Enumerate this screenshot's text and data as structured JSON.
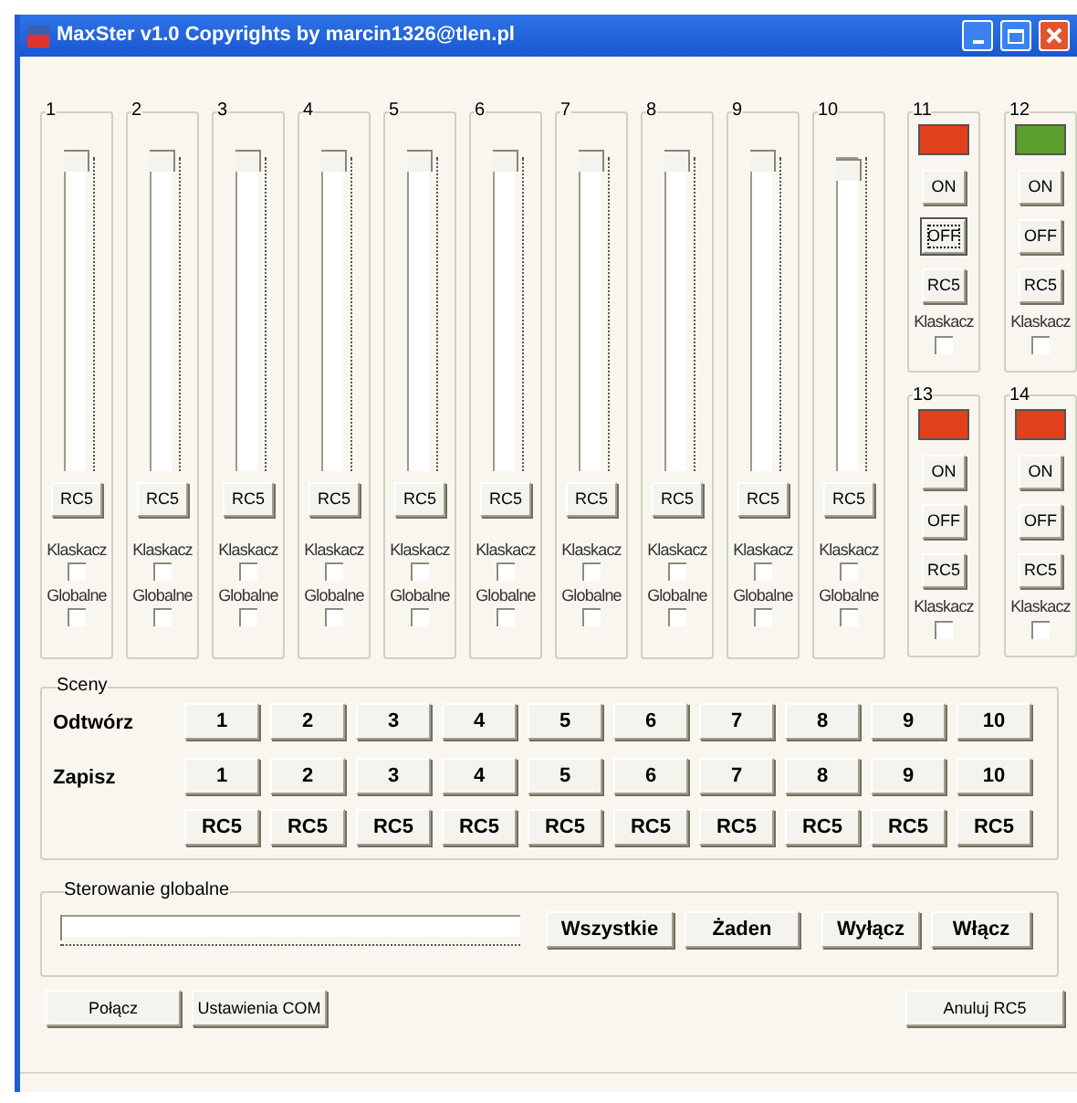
{
  "window": {
    "title": "MaxSter v1.0 Copyrights by marcin1326@tlen.pl"
  },
  "channels": [
    {
      "label": "1",
      "level": 1,
      "rc5": "RC5",
      "clap_label": "Klaskacz",
      "clap_checked": false,
      "global_label": "Globalne",
      "global_checked": false
    },
    {
      "label": "2",
      "level": 1,
      "rc5": "RC5",
      "clap_label": "Klaskacz",
      "clap_checked": false,
      "global_label": "Globalne",
      "global_checked": false
    },
    {
      "label": "3",
      "level": 1,
      "rc5": "RC5",
      "clap_label": "Klaskacz",
      "clap_checked": false,
      "global_label": "Globalne",
      "global_checked": false
    },
    {
      "label": "4",
      "level": 1,
      "rc5": "RC5",
      "clap_label": "Klaskacz",
      "clap_checked": false,
      "global_label": "Globalne",
      "global_checked": false
    },
    {
      "label": "5",
      "level": 1,
      "rc5": "RC5",
      "clap_label": "Klaskacz",
      "clap_checked": false,
      "global_label": "Globalne",
      "global_checked": false
    },
    {
      "label": "6",
      "level": 1,
      "rc5": "RC5",
      "clap_label": "Klaskacz",
      "clap_checked": false,
      "global_label": "Globalne",
      "global_checked": false
    },
    {
      "label": "7",
      "level": 1,
      "rc5": "RC5",
      "clap_label": "Klaskacz",
      "clap_checked": false,
      "global_label": "Globalne",
      "global_checked": false
    },
    {
      "label": "8",
      "level": 1,
      "rc5": "RC5",
      "clap_label": "Klaskacz",
      "clap_checked": false,
      "global_label": "Globalne",
      "global_checked": false
    },
    {
      "label": "9",
      "level": 1,
      "rc5": "RC5",
      "clap_label": "Klaskacz",
      "clap_checked": false,
      "global_label": "Globalne",
      "global_checked": false
    },
    {
      "label": "10",
      "level": 0.97,
      "rc5": "RC5",
      "clap_label": "Klaskacz",
      "clap_checked": false,
      "global_label": "Globalne",
      "global_checked": false
    }
  ],
  "switches": [
    {
      "label": "11",
      "color": "#e0401c",
      "buttons": [
        {
          "label": "ON",
          "focused": false
        },
        {
          "label": "OFF",
          "focused": true
        },
        {
          "label": "RC5",
          "focused": false
        }
      ],
      "clap_label": "Klaskacz",
      "clap_checked": false
    },
    {
      "label": "12",
      "color": "#5a9e2e",
      "buttons": [
        {
          "label": "ON",
          "focused": false
        },
        {
          "label": "OFF",
          "focused": false
        },
        {
          "label": "RC5",
          "focused": false
        }
      ],
      "clap_label": "Klaskacz",
      "clap_checked": false
    },
    {
      "label": "13",
      "color": "#e0401c",
      "buttons": [
        {
          "label": "ON",
          "focused": false
        },
        {
          "label": "OFF",
          "focused": false
        },
        {
          "label": "RC5",
          "focused": false
        }
      ],
      "clap_label": "Klaskacz",
      "clap_checked": false
    },
    {
      "label": "14",
      "color": "#e0401c",
      "buttons": [
        {
          "label": "ON",
          "focused": false
        },
        {
          "label": "OFF",
          "focused": false
        },
        {
          "label": "RC5",
          "focused": false
        }
      ],
      "clap_label": "Klaskacz",
      "clap_checked": false
    }
  ],
  "scenes": {
    "title": "Sceny",
    "rows": [
      {
        "label": "Odtwórz",
        "buttons": [
          "1",
          "2",
          "3",
          "4",
          "5",
          "6",
          "7",
          "8",
          "9",
          "10"
        ]
      },
      {
        "label": "Zapisz",
        "buttons": [
          "1",
          "2",
          "3",
          "4",
          "5",
          "6",
          "7",
          "8",
          "9",
          "10"
        ]
      },
      {
        "buttons": [
          "RC5",
          "RC5",
          "RC5",
          "RC5",
          "RC5",
          "RC5",
          "RC5",
          "RC5",
          "RC5",
          "RC5"
        ]
      }
    ]
  },
  "global_control": {
    "title": "Sterowanie globalne",
    "level": 0,
    "buttons": [
      "Wszystkie",
      "Żaden",
      "Wyłącz",
      "Włącz"
    ]
  },
  "footer": {
    "left_buttons": [
      "Połącz",
      "Ustawienia COM"
    ],
    "right_button": "Anuluj RC5"
  }
}
